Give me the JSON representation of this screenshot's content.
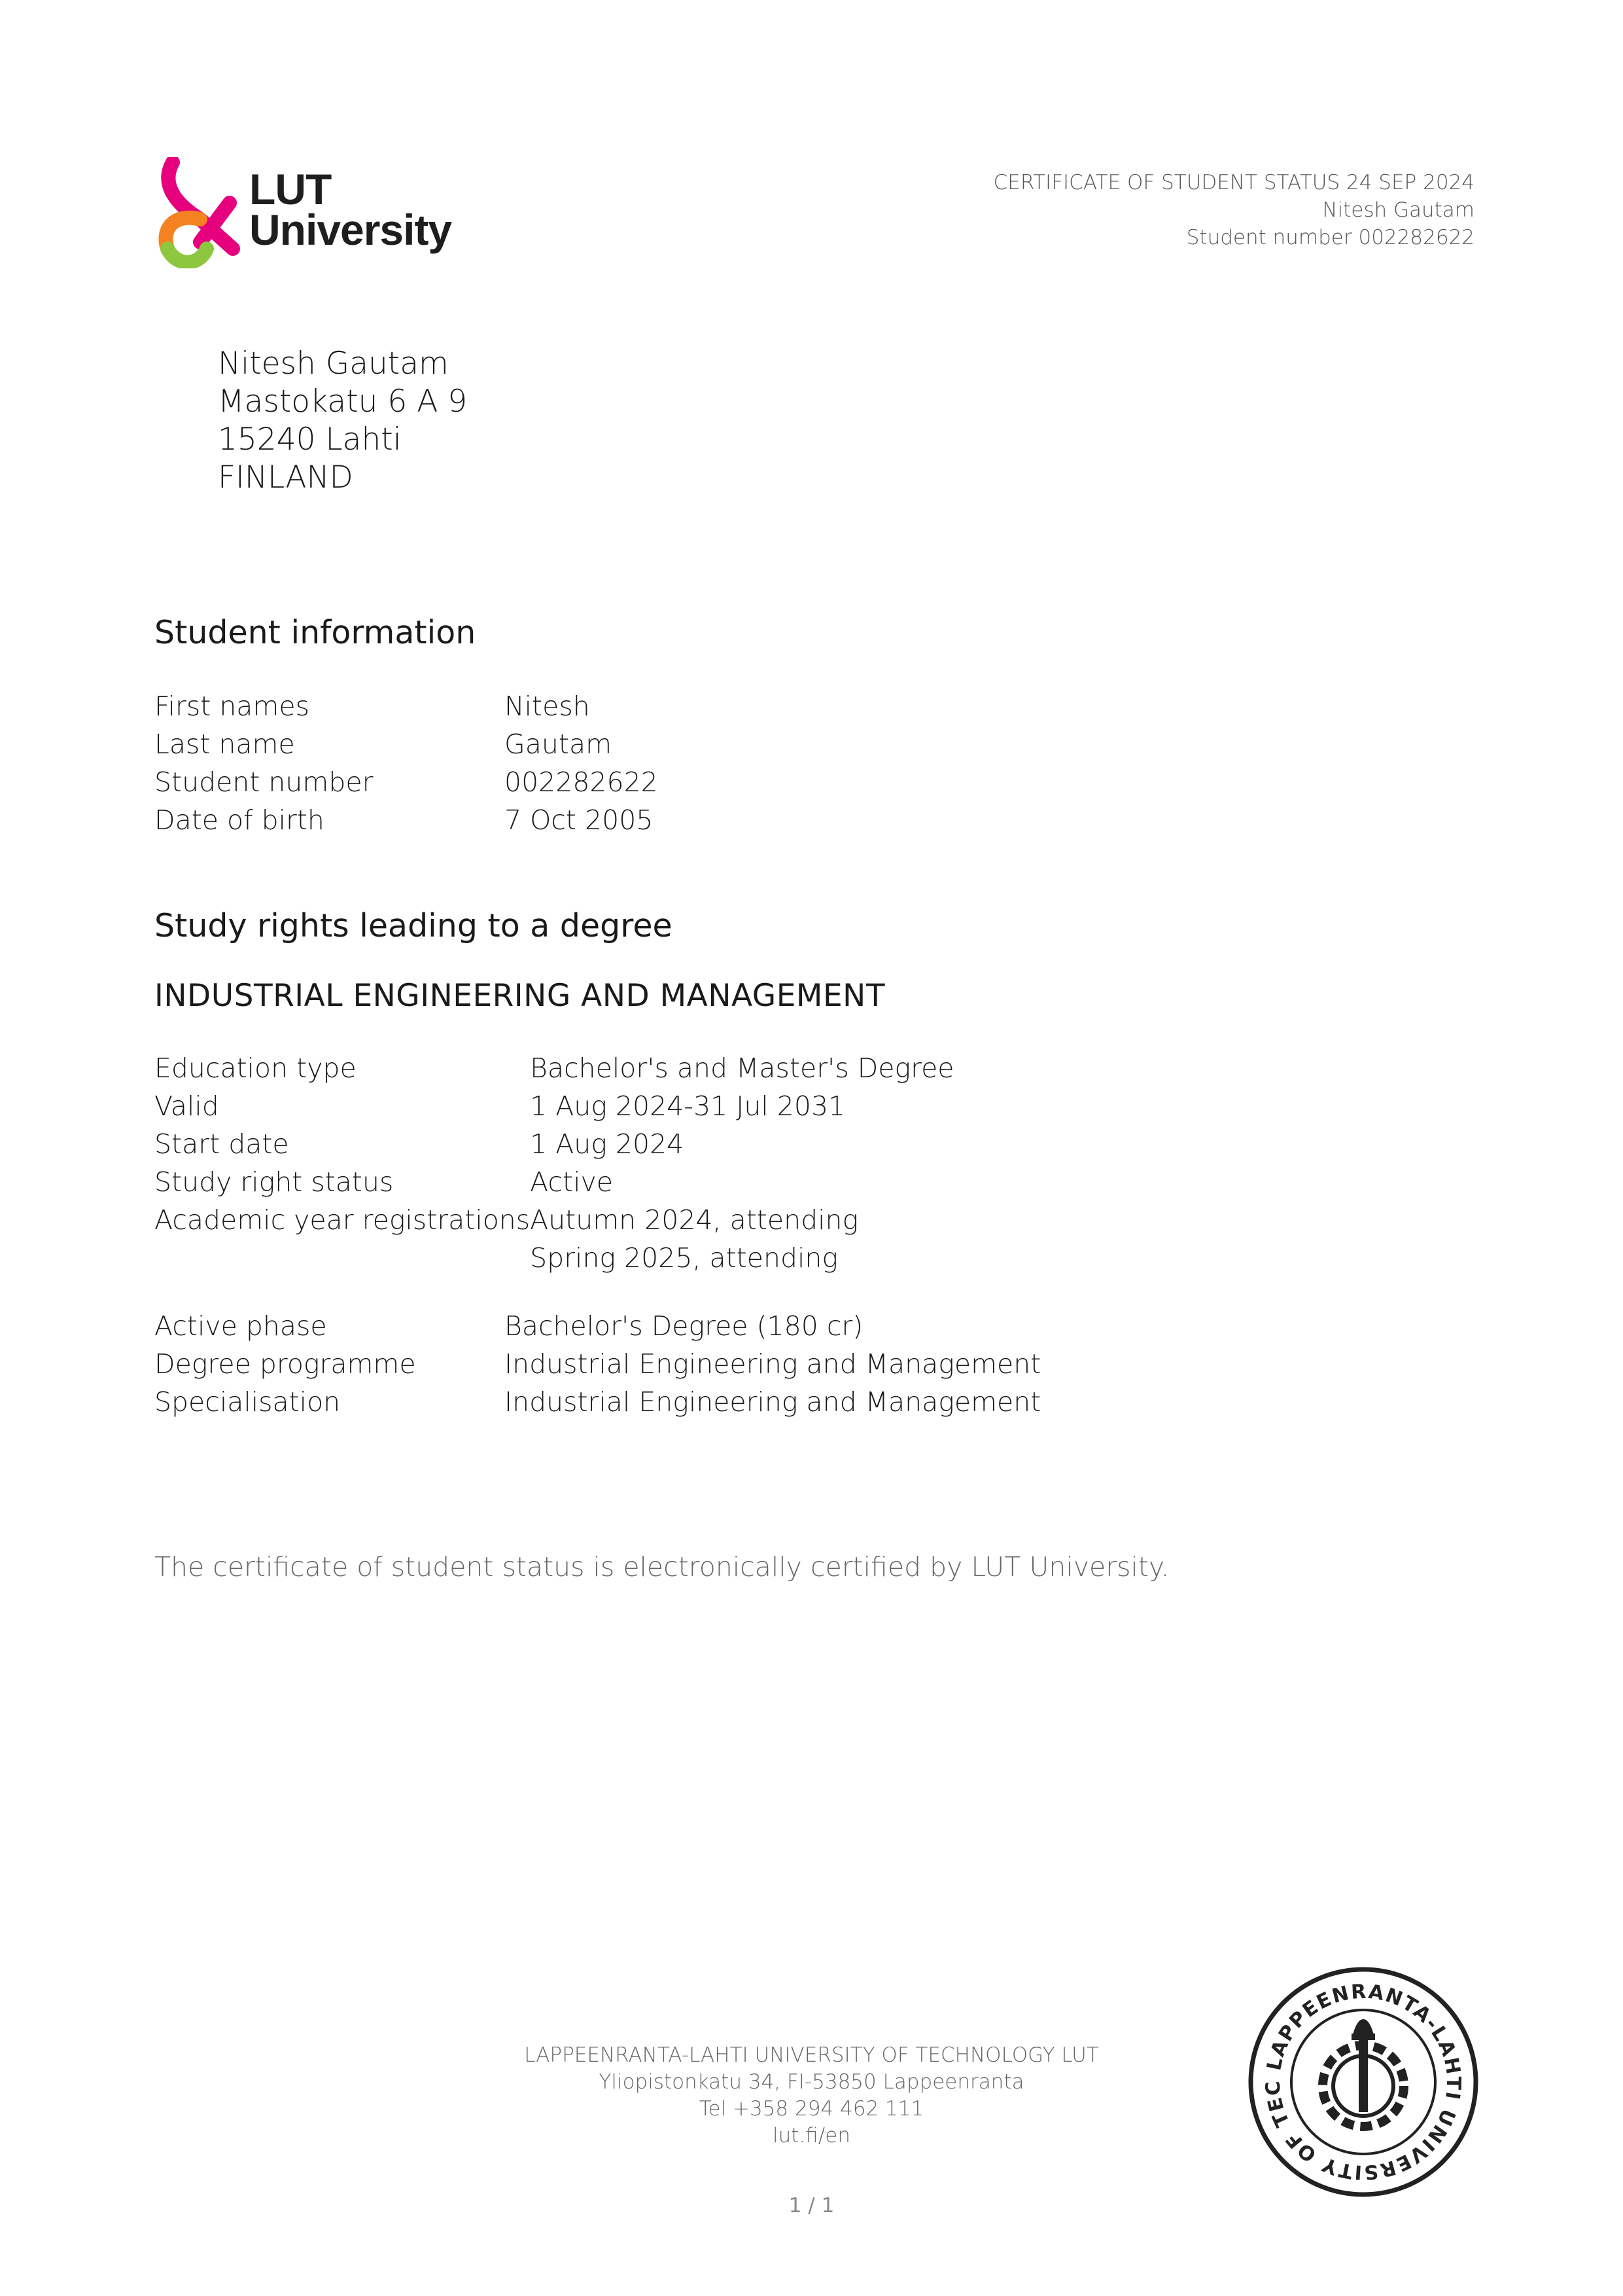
{
  "logo": {
    "line1": "LUT",
    "line2": "University"
  },
  "header": {
    "line1": "CERTIFICATE OF STUDENT STATUS 24 SEP 2024",
    "line2": "Nitesh Gautam",
    "line3": "Student number 002282622"
  },
  "address": [
    "Nitesh Gautam",
    "Mastokatu 6 A 9",
    "15240 Lahti",
    "FINLAND"
  ],
  "student_info": {
    "title": "Student information",
    "rows": [
      {
        "label": "First names",
        "value": "Nitesh"
      },
      {
        "label": "Last name",
        "value": "Gautam"
      },
      {
        "label": "Student number",
        "value": "002282622"
      },
      {
        "label": "Date of birth",
        "value": "7 Oct 2005"
      }
    ]
  },
  "study_rights": {
    "title": "Study rights leading to a degree",
    "programme": "INDUSTRIAL ENGINEERING AND MANAGEMENT",
    "rows": [
      {
        "label": "Education type",
        "value": "Bachelor's and Master's Degree"
      },
      {
        "label": "Valid",
        "value": "1 Aug 2024-31 Jul 2031"
      },
      {
        "label": "Start date",
        "value": "1 Aug 2024"
      },
      {
        "label": "Study right status",
        "value": "Active"
      },
      {
        "label": "Academic year registrations",
        "value": "Autumn 2024, attending"
      },
      {
        "label": "",
        "value": "Spring 2025, attending"
      }
    ],
    "phase_rows": [
      {
        "label": "Active phase",
        "value": "Bachelor's Degree (180 cr)"
      },
      {
        "label": "Degree programme",
        "value": "Industrial Engineering and Management"
      },
      {
        "label": "Specialisation",
        "value": "Industrial Engineering and Management"
      }
    ]
  },
  "certification_note": "The certificate of student status is electronically certified by LUT University.",
  "footer": {
    "line1": "LAPPEENRANTA-LAHTI UNIVERSITY OF TECHNOLOGY LUT",
    "line2": "Yliopistonkatu 34, FI-53850 Lappeenranta",
    "line3": "Tel +358 294 462 111",
    "line4": "lut.fi/en"
  },
  "page_number": "1 / 1",
  "seal_text": "LAPPEENRANTA-LAHTI UNIVERSITY OF TECHNOLOGY LUT"
}
